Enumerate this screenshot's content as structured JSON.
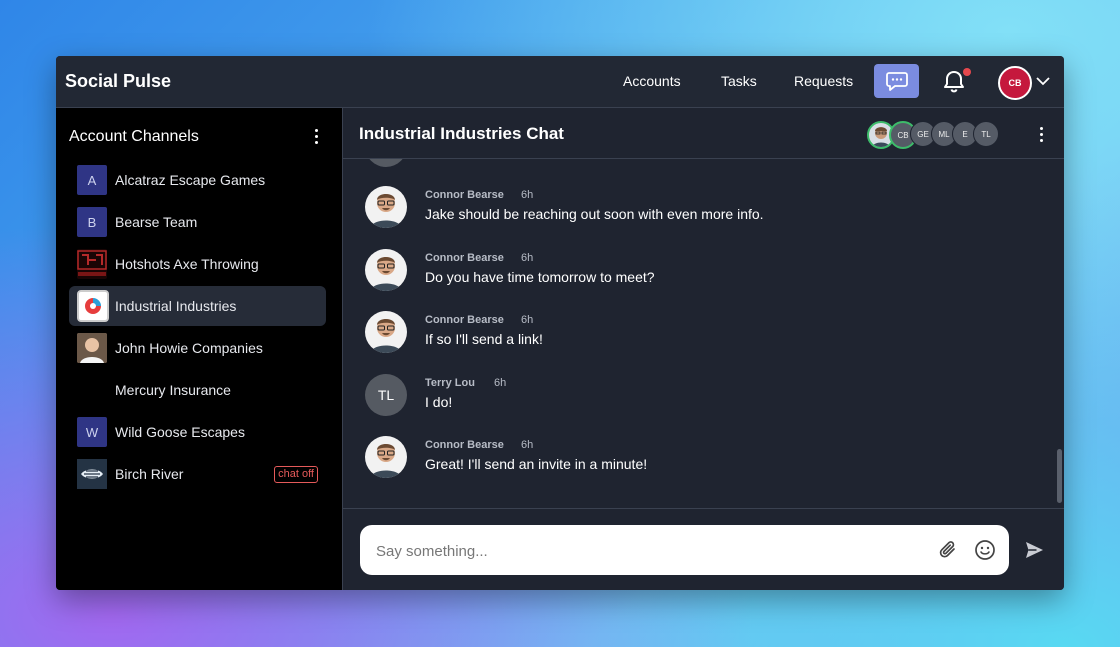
{
  "app": {
    "title": "Social Pulse",
    "nav": {
      "accounts": "Accounts",
      "tasks": "Tasks",
      "requests": "Requests"
    },
    "user_initials": "CB"
  },
  "sidebar": {
    "title": "Account Channels",
    "channels": [
      {
        "label": "Alcatraz Escape Games",
        "icon": "A",
        "icon_type": "letter"
      },
      {
        "label": "Bearse Team",
        "icon": "B",
        "icon_type": "letter"
      },
      {
        "label": "Hotshots Axe Throwing",
        "icon": "hotshots-logo",
        "icon_type": "image"
      },
      {
        "label": "Industrial Industries",
        "icon": "industrial-logo",
        "icon_type": "image",
        "active": true
      },
      {
        "label": "John Howie Companies",
        "icon": "john-howie-photo",
        "icon_type": "image"
      },
      {
        "label": "Mercury Insurance",
        "icon": "",
        "icon_type": "none"
      },
      {
        "label": "Wild Goose Escapes",
        "icon": "W",
        "icon_type": "letter"
      },
      {
        "label": "Birch River",
        "icon": "birch-river-logo",
        "icon_type": "image",
        "badge": "chat off"
      }
    ]
  },
  "chat": {
    "title": "Industrial Industries Chat",
    "members": [
      "CB",
      "GE",
      "ML",
      "E",
      "TL"
    ],
    "messages": [
      {
        "author": "Connor Bearse",
        "time": "6h",
        "text": "Jake should be reaching out soon with even more info.",
        "avatar": "photo"
      },
      {
        "author": "Connor Bearse",
        "time": "6h",
        "text": "Do you have time tomorrow to meet?",
        "avatar": "photo"
      },
      {
        "author": "Connor Bearse",
        "time": "6h",
        "text": "If so I'll send a link!",
        "avatar": "photo"
      },
      {
        "author": "Terry Lou",
        "time": "6h",
        "text": "I do!",
        "avatar": "TL"
      },
      {
        "author": "Connor Bearse",
        "time": "6h",
        "text": "Great! I'll send an invite in a minute!",
        "avatar": "photo"
      }
    ],
    "composer_placeholder": "Say something..."
  },
  "colors": {
    "accent": "#7b8ce0",
    "user_avatar": "#c5183d",
    "notification_dot": "#e5484d",
    "chat_off": "#e55a5a",
    "online": "#3dbb6a"
  }
}
